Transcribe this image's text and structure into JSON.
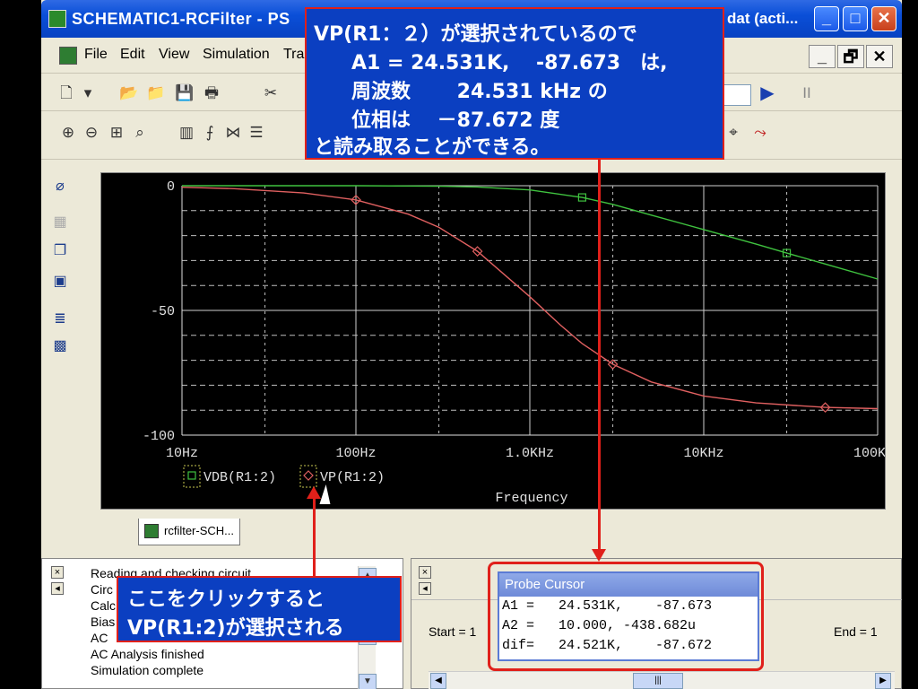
{
  "window": {
    "title": "SCHEMATIC1-RCFilter - PS",
    "title_tail": "dat (acti...",
    "min_label": "_",
    "max_label": "□",
    "close_label": "✕"
  },
  "menu": {
    "items": [
      "File",
      "Edit",
      "View",
      "Simulation",
      "Tra"
    ],
    "mdi_min": "_",
    "mdi_restore": "🗗",
    "mdi_close": "✕"
  },
  "plot": {
    "tab_label": "rcfilter-SCH...",
    "xlabel": "Frequency",
    "legend": [
      {
        "marker": "□",
        "name": "VDB(R1:2)"
      },
      {
        "marker": "◇",
        "name": "VP(R1:2)"
      }
    ]
  },
  "chart_data": {
    "type": "line",
    "x_scale": "log",
    "xlim": [
      10,
      100000
    ],
    "ylim": [
      -100,
      0
    ],
    "x_ticks": [
      {
        "value": 10,
        "label": "10Hz"
      },
      {
        "value": 100,
        "label": "100Hz"
      },
      {
        "value": 1000,
        "label": "1.0KHz"
      },
      {
        "value": 10000,
        "label": "10KHz"
      },
      {
        "value": 100000,
        "label": "100KHz"
      }
    ],
    "y_ticks": [
      {
        "value": 0,
        "label": "0"
      },
      {
        "value": -50,
        "label": "-50"
      },
      {
        "value": -100,
        "label": "-100"
      }
    ],
    "xlabel": "Frequency",
    "grid": true,
    "series": [
      {
        "name": "VDB(R1:2)",
        "color": "#3fc23f",
        "marker": "square",
        "x": [
          10,
          100,
          300,
          500,
          1000,
          2000,
          3000,
          5000,
          10000,
          20000,
          30000,
          50000,
          100000
        ],
        "y": [
          0,
          0,
          -0.2,
          -0.5,
          -1.7,
          -4.7,
          -7.5,
          -11.8,
          -17.6,
          -23.4,
          -27.0,
          -31.4,
          -37.4
        ]
      },
      {
        "name": "VP(R1:2)",
        "color": "#e06060",
        "marker": "diamond",
        "x": [
          10,
          20,
          50,
          100,
          200,
          300,
          500,
          1000,
          1500,
          2000,
          3000,
          5000,
          10000,
          20000,
          50000,
          100000
        ],
        "y": [
          -0.6,
          -1.2,
          -2.9,
          -5.7,
          -11.4,
          -16.7,
          -26.3,
          -44.5,
          -55.9,
          -63.3,
          -71.6,
          -78.7,
          -84.3,
          -87.1,
          -88.9,
          -89.4
        ]
      }
    ]
  },
  "toolbar": {
    "play_label": "▶",
    "pause_label": "II"
  },
  "messages": [
    "Reading and checking circuit",
    "Circ",
    "Calc",
    "Bias",
    "AC",
    "AC Analysis finished",
    "Simulation complete"
  ],
  "range": {
    "start_label": "Start =",
    "start_value": "1",
    "end_label": "End =",
    "end_value": "1"
  },
  "probe_cursor": {
    "title": "Probe Cursor",
    "rows": [
      "A1 =   24.531K,    -87.673",
      "A2 =   10.000, -438.682u",
      "dif=   24.521K,    -87.672"
    ]
  },
  "callout_top": {
    "lines": [
      "VP(R1：２）が選択されているので",
      "A1 = 24.531K,　 -87.673　は,",
      "周波数　　 24.531 kHz の",
      "位相は　 －87.672 度",
      "と読み取ることができる。"
    ]
  },
  "callout_bottom": {
    "lines": [
      "ここをクリックすると",
      "VP(R1:2)が選択される"
    ]
  }
}
